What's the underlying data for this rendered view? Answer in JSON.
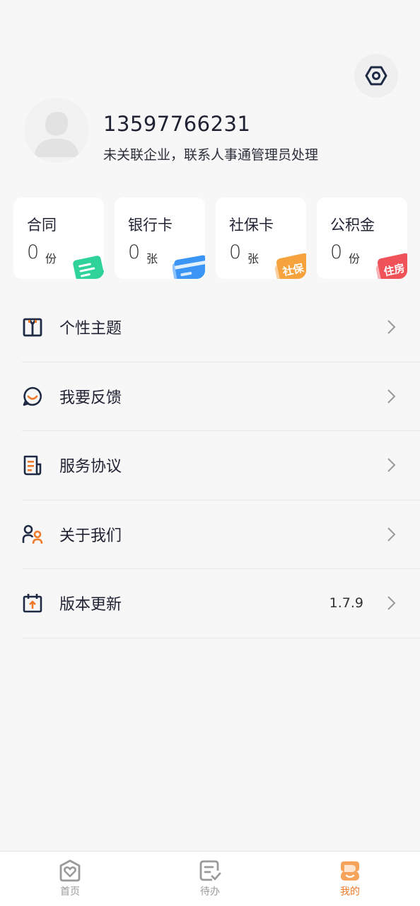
{
  "profile": {
    "phone": "13597766231",
    "org_note": "未关联企业，联系人事通管理员处理"
  },
  "cards": [
    {
      "title": "合同",
      "count": "0",
      "unit": "份",
      "badge": "",
      "color": "#2fd39a"
    },
    {
      "title": "银行卡",
      "count": "0",
      "unit": "张",
      "badge": "",
      "color": "#3b95f5"
    },
    {
      "title": "社保卡",
      "count": "0",
      "unit": "张",
      "badge": "社保",
      "color": "#f6a23d"
    },
    {
      "title": "公积金",
      "count": "0",
      "unit": "份",
      "badge": "住房",
      "color": "#f0525a"
    }
  ],
  "menu": [
    {
      "label": "个性主题",
      "value": "",
      "icon": "theme-shirt-icon"
    },
    {
      "label": "我要反馈",
      "value": "",
      "icon": "feedback-chat-icon"
    },
    {
      "label": "服务协议",
      "value": "",
      "icon": "agreement-document-icon"
    },
    {
      "label": "关于我们",
      "value": "",
      "icon": "about-people-icon"
    },
    {
      "label": "版本更新",
      "value": "1.7.9",
      "icon": "update-calendar-icon"
    }
  ],
  "tabs": [
    {
      "label": "首页",
      "icon": "home-heart-icon",
      "active": false
    },
    {
      "label": "待办",
      "icon": "todo-check-icon",
      "active": false
    },
    {
      "label": "我的",
      "icon": "profile-face-icon",
      "active": true
    }
  ],
  "colors": {
    "accent": "#ef7a2b",
    "icon_dark": "#1f2a44",
    "background": "#f7f7f7"
  }
}
